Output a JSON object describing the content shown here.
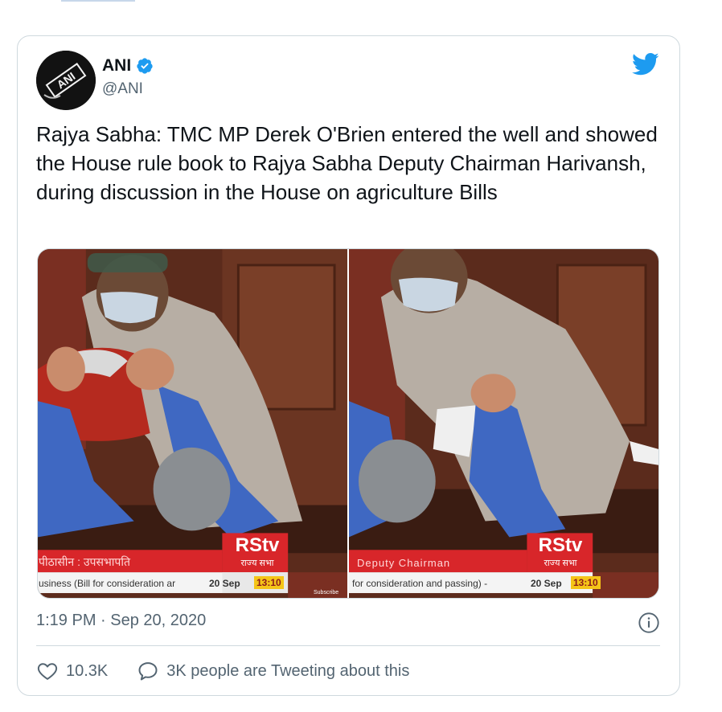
{
  "tweet": {
    "author": {
      "display_name": "ANI",
      "handle": "@ANI",
      "avatar_text": "ANI",
      "verified": true
    },
    "text": "Rajya Sabha: TMC MP Derek O'Brien entered the well and showed the House rule book to Rajya Sabha Deputy Chairman Harivansh, during discussion in the House on agriculture Bills",
    "timestamp": "1:19 PM · Sep 20, 2020",
    "likes": "10.3K",
    "conversation_label": "3K people are Tweeting about this"
  },
  "media": {
    "left": {
      "logo": "RStv",
      "logo_sub": "राज्य सभा",
      "chyron_title": "पीठासीन : उपसभापति",
      "ticker": "usiness (Bill for consideration ar",
      "date": "20 Sep",
      "time": "13:10",
      "subscribe": "Subscribe"
    },
    "right": {
      "logo": "RStv",
      "logo_sub": "राज्य सभा",
      "chyron_title": "Deputy Chairman",
      "ticker": "for consideration and passing) -",
      "date": "20 Sep",
      "time": "13:10"
    }
  },
  "colors": {
    "verified_blue": "#1d9bf0",
    "twitter_blue": "#1d9bf0",
    "chyron_red": "#d8262a",
    "secondary_text": "#536471"
  },
  "icons": {
    "verified": "verified-badge-icon",
    "bird": "twitter-bird-icon",
    "info": "info-icon",
    "like": "heart-icon",
    "reply": "speech-bubble-icon"
  }
}
